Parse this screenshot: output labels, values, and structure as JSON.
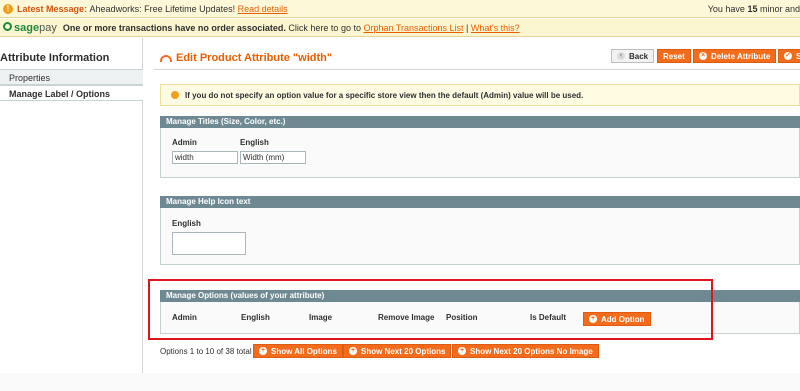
{
  "messages": {
    "latest_label": "Latest Message:",
    "latest_text": "Aheadworks: Free Lifetime Updates!",
    "latest_link": "Read details",
    "right_prefix": "You have ",
    "right_count": "15",
    "right_suffix": " minor and",
    "sagepay_logo_sage": "sage",
    "sagepay_logo_pay": "pay",
    "sagepay_bold": "One or more transactions have no order associated.",
    "sagepay_text": "Click here to go to",
    "sagepay_link": "Orphan Transactions List",
    "sagepay_help": "What's this?"
  },
  "sidebar": {
    "title": "Attribute Information",
    "tabs": [
      {
        "label": "Properties"
      },
      {
        "label": "Manage Label / Options"
      }
    ]
  },
  "header": {
    "title": "Edit Product Attribute \"width\"",
    "buttons": {
      "back": "Back",
      "reset": "Reset",
      "delete": "Delete Attribute",
      "save": "S"
    }
  },
  "notice": "If you do not specify an option value for a specific store view then the default (Admin) value will be used.",
  "titles_section": {
    "heading": "Manage Titles (Size, Color, etc.)",
    "admin_label": "Admin",
    "english_label": "English",
    "admin_value": "width",
    "english_value": "Width (mm)"
  },
  "help_section": {
    "heading": "Manage Help Icon text",
    "english_label": "English"
  },
  "options_section": {
    "heading": "Manage Options (values of your attribute)",
    "columns": [
      "Admin",
      "English",
      "Image",
      "Remove Image",
      "Position",
      "Is Default"
    ],
    "add_button": "Add Option"
  },
  "pager": {
    "text": "Options 1 to 10 of 38 total",
    "show_all": "Show All Options",
    "show_next": "Show Next 20 Options",
    "show_next_no_image": "Show Next 20 Options No Image"
  },
  "colors": {
    "accent": "#eb5e00",
    "button": "#f26c1c",
    "section_header": "#6f8992",
    "highlight": "#e0141e"
  }
}
